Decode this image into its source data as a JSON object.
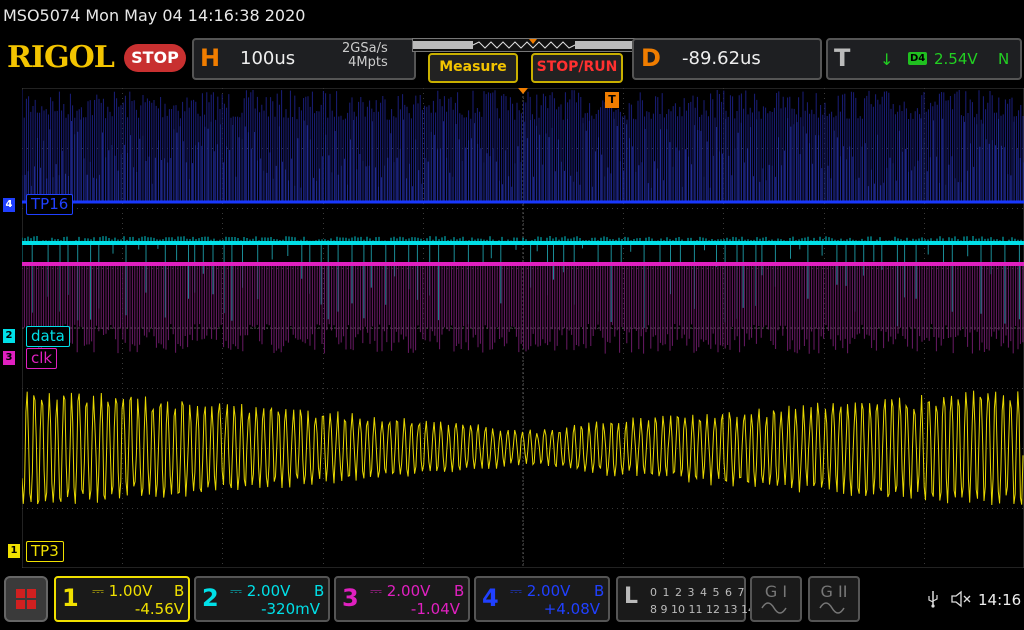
{
  "window": {
    "title": "MSO5074  Mon May 04 14:16:38 2020"
  },
  "brand": {
    "logo": "RIGOL",
    "run_state": "STOP"
  },
  "horizontal": {
    "letter": "H",
    "timebase": "100us",
    "sample_rate": "2GSa/s",
    "memory_depth": "4Mpts"
  },
  "buttons": {
    "measure": "Measure",
    "stop_run": "STOP/RUN"
  },
  "delay": {
    "letter": "D",
    "value": "-89.62us"
  },
  "trigger": {
    "letter": "T",
    "source": "D4",
    "level": "2.54V",
    "mode": "N"
  },
  "channels": [
    {
      "num": "1",
      "scale": "1.00V",
      "coupling_flag": "B",
      "offset": "-4.56V",
      "color": "#f0e000",
      "label": "TP3"
    },
    {
      "num": "2",
      "scale": "2.00V",
      "coupling_flag": "B",
      "offset": "-320mV",
      "color": "#00e0e8",
      "label": "data"
    },
    {
      "num": "3",
      "scale": "2.00V",
      "coupling_flag": "B",
      "offset": "-1.04V",
      "color": "#e020c0",
      "label": "clk"
    },
    {
      "num": "4",
      "scale": "2.00V",
      "coupling_flag": "B",
      "offset": "+4.08V",
      "color": "#2040ff",
      "label": "TP16"
    }
  ],
  "logic": {
    "letter": "L",
    "row1": "0 1 2 3  4 5 6 7",
    "row2": "8 9 10 11 12 13 14 15"
  },
  "gen": {
    "g1": "G I",
    "g2": "G II"
  },
  "status": {
    "time": "14:16"
  },
  "icons": [
    "usb-icon",
    "speaker-muted-icon",
    "menu-grid-icon",
    "trigger-icon"
  ]
}
